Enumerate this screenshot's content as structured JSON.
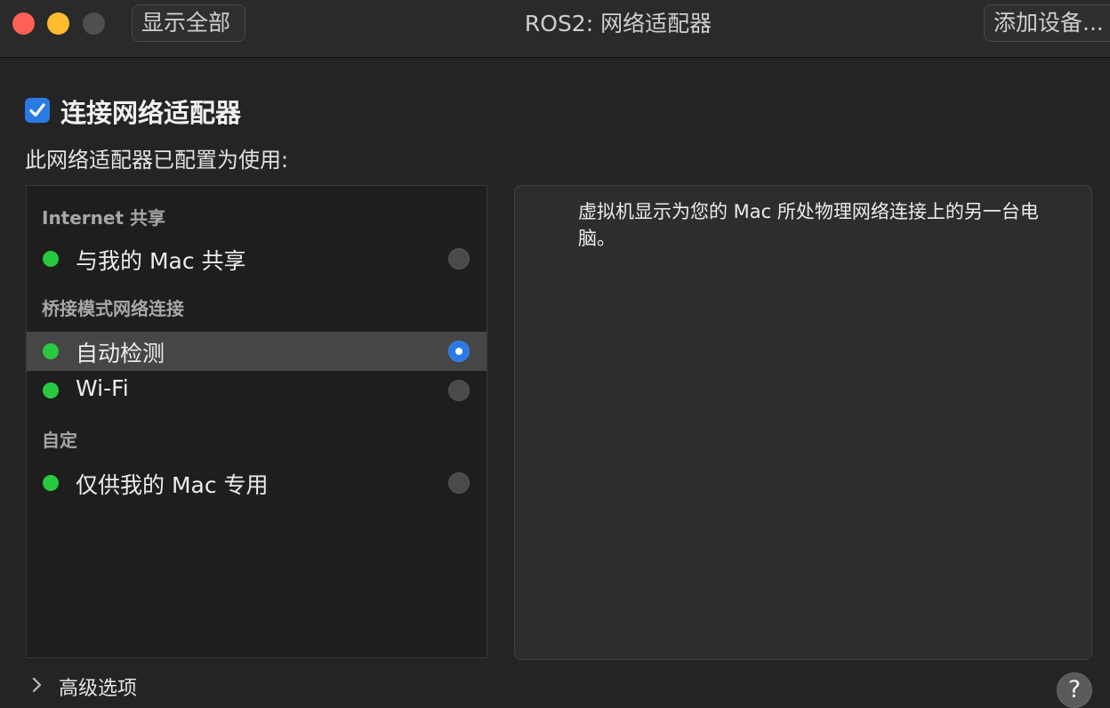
{
  "window": {
    "title": "ROS2: 网络适配器",
    "show_all_label": "显示全部",
    "add_device_label": "添加设备..."
  },
  "connect": {
    "checked": true,
    "label": "连接网络适配器"
  },
  "subtitle": "此网络适配器已配置为使用:",
  "sections": {
    "internet_sharing": "Internet 共享",
    "bridged": "桥接模式网络连接",
    "custom": "自定"
  },
  "options": {
    "share_with_mac": {
      "label": "与我的 Mac 共享",
      "selected": false,
      "status": "connected"
    },
    "autodetect": {
      "label": "自动检测",
      "selected": true,
      "status": "connected"
    },
    "wifi": {
      "label": "Wi-Fi",
      "selected": false,
      "status": "connected"
    },
    "private_to_mac": {
      "label": "仅供我的 Mac 专用",
      "selected": false,
      "status": "connected"
    }
  },
  "description": "虚拟机显示为您的 Mac 所处物理网络连接上的另一台电脑。",
  "advanced_label": "高级选项",
  "help_label": "?",
  "colors": {
    "accent": "#2a7ae4",
    "status_green": "#28c840",
    "close": "#fe5f57",
    "minimize": "#febc2e"
  },
  "icons": {
    "checkbox": "checkmark-icon",
    "advanced": "chevron-right-icon"
  }
}
